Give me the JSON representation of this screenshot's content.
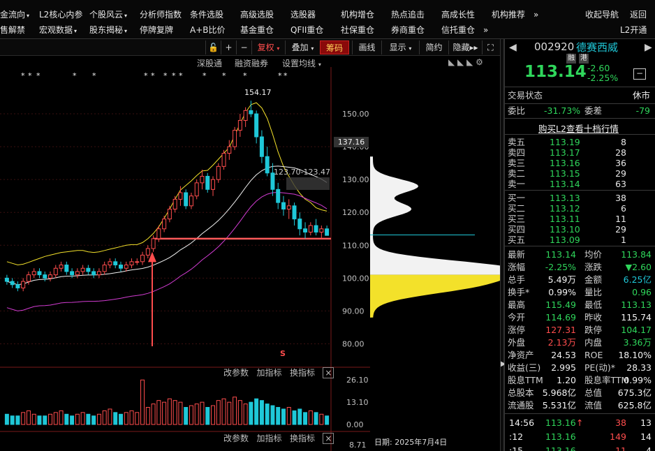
{
  "menu": {
    "row1": [
      {
        "label": "金流向",
        "dd": "▾"
      },
      {
        "label": "L2核心内参",
        "dd": ""
      },
      {
        "label": "个股风云",
        "dd": "▾"
      },
      {
        "label": "分析师指数",
        "dd": ""
      },
      {
        "label": "条件选股",
        "dd": ""
      },
      {
        "label": "高级选股",
        "dd": ""
      },
      {
        "label": "选股器",
        "dd": ""
      },
      {
        "label": "机构增仓",
        "dd": ""
      },
      {
        "label": "热点追击",
        "dd": ""
      },
      {
        "label": "高成长性",
        "dd": ""
      },
      {
        "label": "机构推荐",
        "dd": ""
      },
      {
        "label": "»",
        "dd": ""
      },
      {
        "label": "收起导航",
        "dd": ""
      },
      {
        "label": "返回",
        "dd": ""
      }
    ],
    "row2": [
      {
        "label": "售解禁",
        "dd": ""
      },
      {
        "label": "宏观数据",
        "dd": "▾"
      },
      {
        "label": "股东揭秘",
        "dd": "▾"
      },
      {
        "label": "停牌复牌",
        "dd": ""
      },
      {
        "label": "A+B比价",
        "dd": ""
      },
      {
        "label": "基金重仓",
        "dd": ""
      },
      {
        "label": "QFII重仓",
        "dd": ""
      },
      {
        "label": "社保重仓",
        "dd": ""
      },
      {
        "label": "券商重仓",
        "dd": ""
      },
      {
        "label": "信托重仓",
        "dd": ""
      },
      {
        "label": "»",
        "dd": ""
      },
      {
        "label": "L2开通",
        "dd": ""
      }
    ]
  },
  "toolbar": {
    "lock": "🔓",
    "plus": "+",
    "minus": "−",
    "fuquan": "复权",
    "diejia": "叠加",
    "chouma": "筹码",
    "huaxian": "画线",
    "xianshi": "显示",
    "jianyue": "简约",
    "yincang": "隐藏",
    "more": "▸▸",
    "fullscreen": "⛶"
  },
  "subbar": {
    "shengang": "深股通",
    "rongzi": "融资融券",
    "settings": "设置均线"
  },
  "indicator_bar": {
    "gai": "改参数",
    "jia": "加指标",
    "huan": "换指标",
    "close": "×"
  },
  "chart_labels": {
    "high_mark": "154.17",
    "range_mark": "123.70-123.47",
    "cur_price_tag": "137.16",
    "date_label": "日期: 2025年7月4日",
    "y_ticks": [
      "150.00",
      "140.00",
      "130.00",
      "120.00",
      "110.00",
      "100.00",
      "90.00",
      "80.00"
    ],
    "vol_ticks": [
      "26.10",
      "13.10",
      "0.00"
    ],
    "bottom_tick": "8.71",
    "s_mark": "S"
  },
  "quote": {
    "code": "002920",
    "name": "德赛西威",
    "badge1": "融",
    "badge2": "港",
    "price": "113.14",
    "change": "-2.60",
    "change_pct": "-2.25%",
    "status_label": "交易状态",
    "status_value": "休市",
    "weibi_label": "委比",
    "weibi_value": "-31.73%",
    "weicha_label": "委差",
    "weicha_value": "-79",
    "l2_link": "购买L2查看十档行情",
    "sell": [
      {
        "label": "卖五",
        "price": "113.19",
        "vol": "8"
      },
      {
        "label": "卖四",
        "price": "113.17",
        "vol": "28"
      },
      {
        "label": "卖三",
        "price": "113.16",
        "vol": "36"
      },
      {
        "label": "卖二",
        "price": "113.15",
        "vol": "29"
      },
      {
        "label": "卖一",
        "price": "113.14",
        "vol": "63"
      }
    ],
    "buy": [
      {
        "label": "买一",
        "price": "113.13",
        "vol": "38"
      },
      {
        "label": "买二",
        "price": "113.12",
        "vol": "6"
      },
      {
        "label": "买三",
        "price": "113.11",
        "vol": "11"
      },
      {
        "label": "买四",
        "price": "113.10",
        "vol": "29"
      },
      {
        "label": "买五",
        "price": "113.09",
        "vol": "1"
      }
    ],
    "stats": [
      {
        "l1": "最新",
        "v1": "113.14",
        "c1": "green",
        "l2": "均价",
        "v2": "113.84",
        "c2": "green"
      },
      {
        "l1": "涨幅",
        "v1": "-2.25%",
        "c1": "green",
        "l2": "涨跌",
        "v2": "▼2.60",
        "c2": "green"
      },
      {
        "l1": "总手",
        "v1": "5.49万",
        "c1": "white",
        "l2": "金额",
        "v2": "6.25亿",
        "c2": "cyan"
      },
      {
        "l1": "换手*",
        "v1": "0.99%",
        "c1": "white",
        "l2": "量比",
        "v2": "0.96",
        "c2": "green"
      },
      {
        "l1": "最高",
        "v1": "115.49",
        "c1": "green",
        "l2": "最低",
        "v2": "113.13",
        "c2": "green"
      },
      {
        "l1": "今开",
        "v1": "114.69",
        "c1": "green",
        "l2": "昨收",
        "v2": "115.74",
        "c2": "white"
      },
      {
        "l1": "涨停",
        "v1": "127.31",
        "c1": "red",
        "l2": "跌停",
        "v2": "104.17",
        "c2": "green"
      },
      {
        "l1": "外盘",
        "v1": "2.13万",
        "c1": "red",
        "l2": "内盘",
        "v2": "3.36万",
        "c2": "green"
      },
      {
        "l1": "净资产",
        "v1": "24.53",
        "c1": "white",
        "l2": "ROE",
        "v2": "18.10%",
        "c2": "white"
      },
      {
        "l1": "收益(三)",
        "v1": "2.995",
        "c1": "white",
        "l2": "PE(动)*",
        "v2": "28.33",
        "c2": "white"
      },
      {
        "l1": "股息TTM",
        "v1": "1.20",
        "c1": "white",
        "l2": "股息率TTM",
        "v2": "0.99%",
        "c2": "white"
      },
      {
        "l1": "总股本",
        "v1": "5.968亿",
        "c1": "white",
        "l2": "总值",
        "v2": "675.3亿",
        "c2": "white"
      },
      {
        "l1": "流通股",
        "v1": "5.531亿",
        "c1": "white",
        "l2": "流值",
        "v2": "625.8亿",
        "c2": "white"
      }
    ],
    "ticks": [
      {
        "time": "14:56",
        "price": "113.16",
        "arrow": "↑",
        "vol": "38",
        "num": "13"
      },
      {
        "time": ":12",
        "price": "113.16",
        "arrow": "",
        "vol": "149",
        "num": "14"
      },
      {
        "time": ":15",
        "price": "113.16",
        "arrow": "",
        "vol": "11",
        "num": "4"
      }
    ]
  },
  "chart_data": {
    "type": "candlestick",
    "ylim": [
      75,
      160
    ],
    "price_ticks": [
      150,
      140,
      130,
      120,
      110,
      100,
      90,
      80
    ],
    "candles": [
      [
        100,
        101,
        98,
        99
      ],
      [
        99,
        100,
        97,
        98
      ],
      [
        98,
        99,
        96,
        97
      ],
      [
        97,
        100,
        96,
        99
      ],
      [
        99,
        102,
        98,
        101
      ],
      [
        101,
        103,
        100,
        102
      ],
      [
        102,
        103,
        100,
        101
      ],
      [
        101,
        102,
        99,
        100
      ],
      [
        100,
        102,
        99,
        101
      ],
      [
        101,
        104,
        100,
        103
      ],
      [
        103,
        105,
        102,
        104
      ],
      [
        104,
        105,
        101,
        102
      ],
      [
        102,
        103,
        100,
        101
      ],
      [
        101,
        103,
        100,
        102
      ],
      [
        102,
        104,
        101,
        103
      ],
      [
        103,
        104,
        101,
        102
      ],
      [
        102,
        103,
        100,
        101
      ],
      [
        101,
        103,
        100,
        102
      ],
      [
        102,
        105,
        101,
        104
      ],
      [
        104,
        106,
        103,
        105
      ],
      [
        105,
        106,
        103,
        104
      ],
      [
        104,
        105,
        102,
        103
      ],
      [
        103,
        105,
        102,
        104
      ],
      [
        104,
        106,
        103,
        105
      ],
      [
        105,
        106,
        104,
        105
      ],
      [
        105,
        108,
        104,
        107
      ],
      [
        107,
        110,
        106,
        109
      ],
      [
        109,
        113,
        108,
        112
      ],
      [
        112,
        116,
        111,
        115
      ],
      [
        115,
        119,
        114,
        118
      ],
      [
        118,
        122,
        117,
        121
      ],
      [
        121,
        125,
        120,
        124
      ],
      [
        124,
        128,
        122,
        126
      ],
      [
        126,
        127,
        121,
        122
      ],
      [
        122,
        126,
        121,
        125
      ],
      [
        125,
        130,
        124,
        129
      ],
      [
        129,
        133,
        127,
        131
      ],
      [
        131,
        132,
        126,
        127
      ],
      [
        127,
        131,
        125,
        130
      ],
      [
        130,
        135,
        129,
        134
      ],
      [
        134,
        139,
        133,
        138
      ],
      [
        138,
        142,
        136,
        140
      ],
      [
        140,
        146,
        139,
        145
      ],
      [
        145,
        150,
        143,
        148
      ],
      [
        148,
        152,
        146,
        151
      ],
      [
        151,
        154,
        149,
        150
      ],
      [
        150,
        151,
        141,
        143
      ],
      [
        143,
        145,
        135,
        137
      ],
      [
        137,
        140,
        131,
        132
      ],
      [
        132,
        135,
        125,
        127
      ],
      [
        127,
        129,
        121,
        123
      ],
      [
        123,
        125,
        119,
        121
      ],
      [
        121,
        124,
        118,
        122
      ],
      [
        122,
        123,
        116,
        118
      ],
      [
        118,
        120,
        113,
        115
      ],
      [
        115,
        117,
        112,
        114
      ],
      [
        114,
        117,
        113,
        116
      ],
      [
        116,
        118,
        113,
        114
      ],
      [
        114,
        116,
        112,
        115
      ],
      [
        115,
        116,
        113,
        113
      ]
    ],
    "volume": [
      6,
      5,
      5,
      7,
      8,
      6,
      5,
      5,
      6,
      7,
      8,
      6,
      5,
      6,
      7,
      6,
      5,
      6,
      8,
      9,
      7,
      6,
      7,
      8,
      7,
      26,
      10,
      12,
      14,
      13,
      15,
      14,
      13,
      10,
      11,
      12,
      13,
      10,
      11,
      14,
      15,
      13,
      16,
      14,
      12,
      13,
      15,
      14,
      12,
      11,
      10,
      9,
      10,
      8,
      9,
      7,
      8,
      7,
      6,
      5
    ],
    "vol_ticks": [
      26.1,
      13.1,
      0.0
    ]
  }
}
